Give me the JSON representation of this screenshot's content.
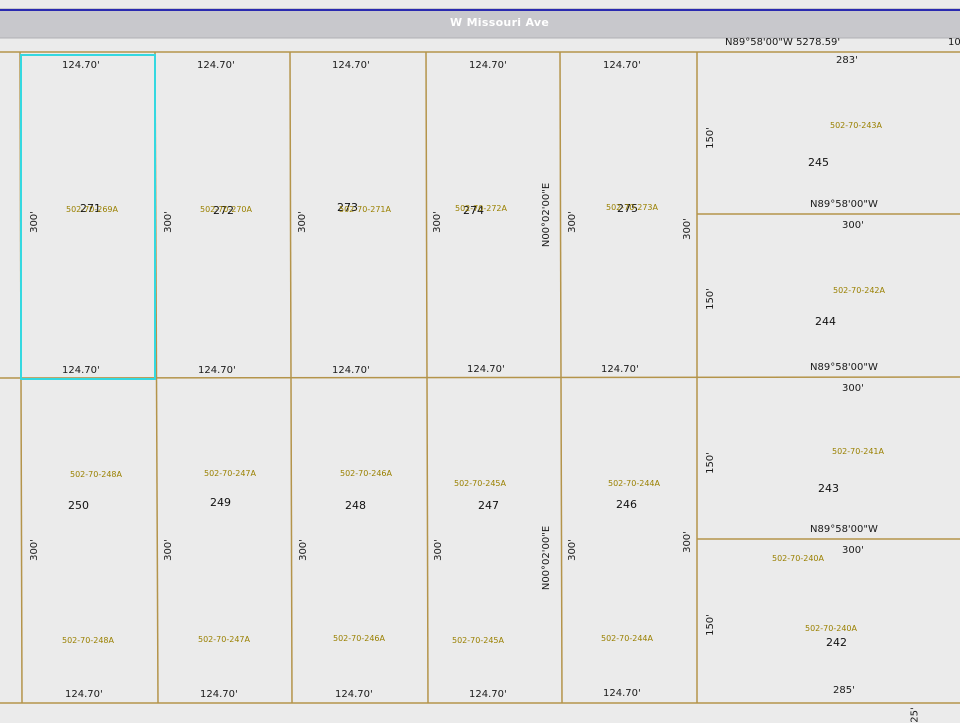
{
  "road": {
    "name": "W Missouri Ave",
    "bearing_top": "N89°58'00\"W  5278.59'",
    "edge_top": "10",
    "edge_bottom": "25'"
  },
  "parcels_top": [
    {
      "num": "271",
      "apn": "502-70-269A",
      "top": "124.70'",
      "bottom": "124.70'",
      "side": "300'",
      "selected": true
    },
    {
      "num": "272",
      "apn": "502-70-270A",
      "top": "124.70'",
      "bottom": "124.70'",
      "side": "300'"
    },
    {
      "num": "273",
      "apn": "502-70-271A",
      "top": "124.70'",
      "bottom": "124.70'",
      "side": "300'"
    },
    {
      "num": "274",
      "apn": "502-70-272A",
      "top": "124.70'",
      "bottom": "124.70'",
      "side": "300'"
    },
    {
      "num": "275",
      "apn": "502-70-273A",
      "top": "124.70'",
      "bottom": "124.70'",
      "side": "300'"
    }
  ],
  "parcels_bottom": [
    {
      "num": "250",
      "apn": "502-70-248A",
      "apn2": "502-70-248A",
      "bottom": "124.70'",
      "side": "300'"
    },
    {
      "num": "249",
      "apn": "502-70-247A",
      "apn2": "502-70-247A",
      "bottom": "124.70'",
      "side": "300'"
    },
    {
      "num": "248",
      "apn": "502-70-246A",
      "apn2": "502-70-246A",
      "bottom": "124.70'",
      "side": "300'"
    },
    {
      "num": "247",
      "apn": "502-70-245A",
      "apn2": "502-70-245A",
      "bottom": "124.70'",
      "side": "300'"
    },
    {
      "num": "246",
      "apn": "502-70-244A",
      "apn2": "502-70-244A",
      "bottom": "124.70'",
      "side": "300'"
    }
  ],
  "bearing_vertical": "N00°02'00\"E",
  "parcels_right": [
    {
      "num": "245",
      "apn": "502-70-243A",
      "top": "283'",
      "side": "150'",
      "bearing_below": "N89°58'00\"W"
    },
    {
      "num": "244",
      "apn": "502-70-242A",
      "top": "300'",
      "side": "150'",
      "bearing_below": "N89°58'00\"W"
    },
    {
      "num": "243",
      "apn": "502-70-241A",
      "top": "300'",
      "side": "150'",
      "bearing_below": "N89°58'00\"W"
    },
    {
      "num": "242",
      "apn": "502-70-240A",
      "apn_top": "502-70-240A",
      "top": "300'",
      "side": "150'",
      "bottom": "285'"
    }
  ],
  "right_block_side": "300'",
  "colors": {
    "parcel_line": "#b4944a",
    "selected": "#34d8e0",
    "road": "#c8c8cc",
    "road_line": "#2a2ab0",
    "apn_text": "#9a8000",
    "background": "#ebebeb"
  }
}
